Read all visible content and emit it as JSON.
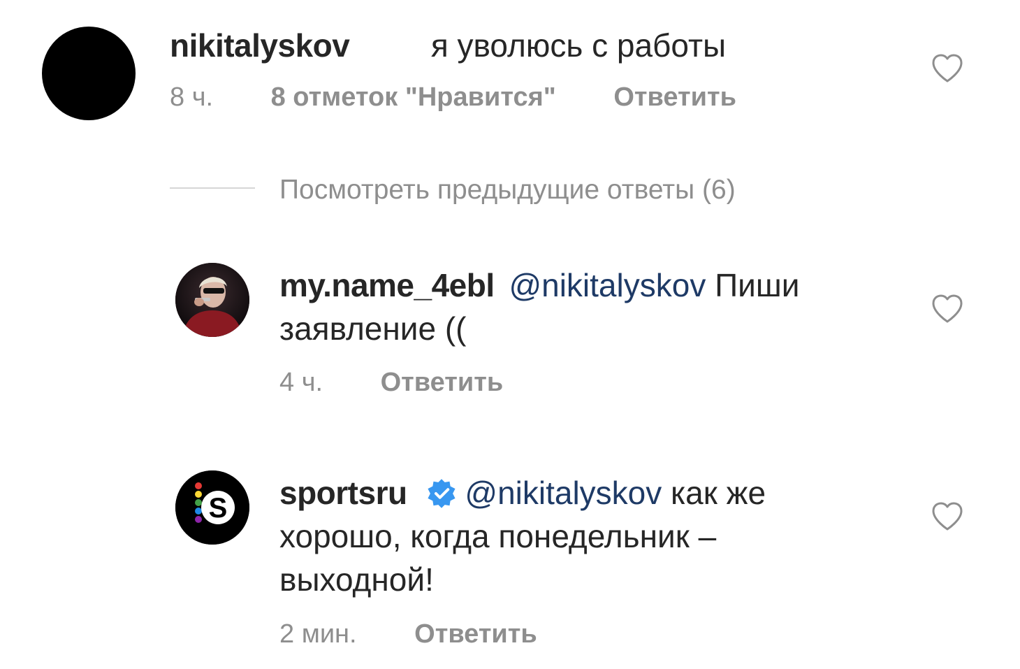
{
  "comment": {
    "username": "nikitalyskov",
    "text": "я уволюсь с работы",
    "time": "8 ч.",
    "likes": "8 отметок \"Нравится\"",
    "reply_label": "Ответить"
  },
  "view_previous": "Посмотреть предыдущие ответы (6)",
  "replies": [
    {
      "username": "my.name_4ebl",
      "mention": "@nikitalyskov",
      "text_line1": "Пиши",
      "text_line2": "заявление ((",
      "time": "4 ч.",
      "reply_label": "Ответить"
    },
    {
      "username": "sportsru",
      "verified": true,
      "mention": "@nikitalyskov",
      "text_line1": "как же",
      "text_line2": "хорошо, когда понедельник –",
      "text_line3": "выходной!",
      "time": "2 мин.",
      "reply_label": "Ответить"
    }
  ],
  "colors": {
    "text": "#262626",
    "muted": "#8e8e8e",
    "mention": "#1e3a66",
    "verified": "#3897f0"
  },
  "icons": [
    "heart-icon",
    "verified-badge-icon"
  ]
}
